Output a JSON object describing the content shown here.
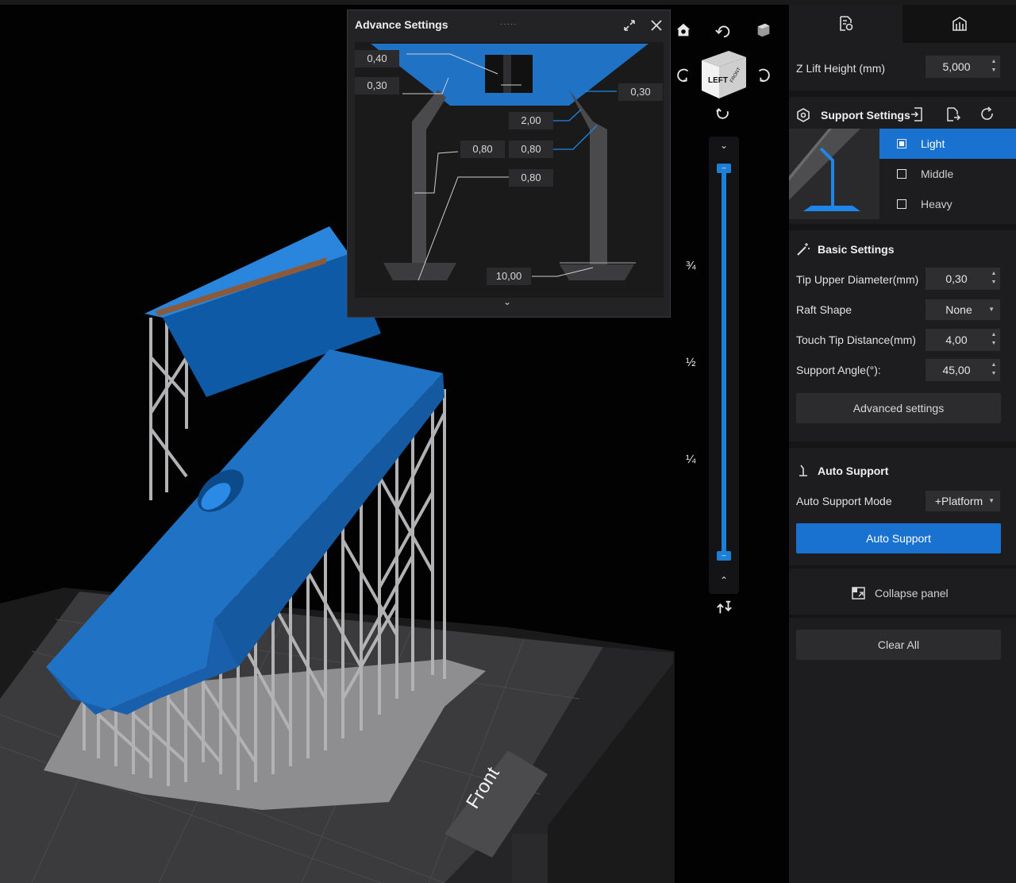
{
  "popup": {
    "title": "Advance Settings",
    "grip": "·····",
    "values": [
      "0,40",
      "0,30",
      "0,30",
      "2,00",
      "0,80",
      "0,80",
      "0,80",
      "10,00"
    ]
  },
  "viewcube": {
    "left_label": "LEFT",
    "front_label": "FRONT"
  },
  "slider": {
    "labels": [
      "¾",
      "½",
      "¼"
    ]
  },
  "platform": {
    "front_label": "Front"
  },
  "panel": {
    "z_lift": {
      "label": "Z Lift Height (mm)",
      "value": "5,000"
    },
    "support_settings": {
      "title": "Support Settings",
      "presets": [
        {
          "label": "Light",
          "selected": true
        },
        {
          "label": "Middle",
          "selected": false
        },
        {
          "label": "Heavy",
          "selected": false
        }
      ]
    },
    "basic": {
      "title": "Basic Settings",
      "tip_upper": {
        "label": "Tip Upper Diameter(mm)",
        "value": "0,30"
      },
      "raft_shape": {
        "label": "Raft Shape",
        "value": "None"
      },
      "touch_tip": {
        "label": "Touch Tip Distance(mm)",
        "value": "4,00"
      },
      "support_angle": {
        "label": "Support Angle(°):",
        "value": "45,00"
      },
      "advanced_button": "Advanced settings"
    },
    "auto": {
      "title": "Auto Support",
      "mode_label": "Auto Support Mode",
      "mode_value": "+Platform",
      "button": "Auto Support"
    },
    "collapse": "Collapse  panel",
    "clear_all": "Clear All"
  },
  "colors": {
    "accent": "#1a72d0",
    "model": "#1f72c4",
    "support": "#a9a9ab",
    "panel": "#1d1d1f"
  }
}
